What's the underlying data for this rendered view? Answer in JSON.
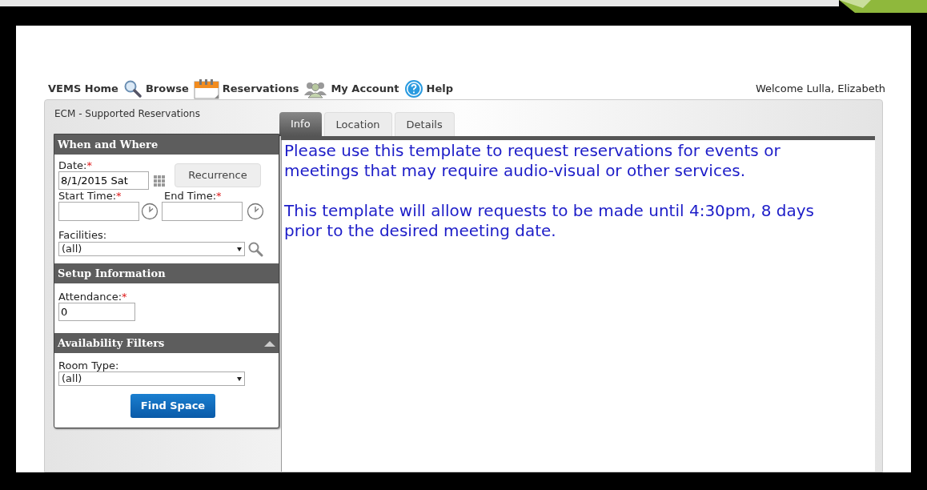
{
  "nav": {
    "items": [
      {
        "label": "VEMS Home"
      },
      {
        "label": "Browse"
      },
      {
        "label": "Reservations"
      },
      {
        "label": "My Account"
      },
      {
        "label": "Help"
      }
    ],
    "welcome": "Welcome Lulla, Elizabeth"
  },
  "panel_title": "ECM - Supported Reservations",
  "tabs": [
    {
      "label": "Info",
      "selected": true
    },
    {
      "label": "Location",
      "selected": false
    },
    {
      "label": "Details",
      "selected": false
    }
  ],
  "when_where": {
    "title": "When and Where",
    "date": {
      "label": "Date:",
      "required_mark": "*",
      "value": "8/1/2015 Sat"
    },
    "recurrence": "Recurrence",
    "start_time": {
      "label": "Start Time:",
      "required_mark": "*"
    },
    "end_time": {
      "label": "End Time:",
      "required_mark": "*"
    },
    "facilities": {
      "label": "Facilities:",
      "value": "(all)"
    }
  },
  "setup": {
    "title": "Setup Information",
    "attendance": {
      "label": "Attendance:",
      "required_mark": "*",
      "value": "0"
    }
  },
  "filters": {
    "title": "Availability Filters",
    "expanded": true,
    "room_type": {
      "label": "Room Type:",
      "value": "(all)"
    },
    "button": "Find Space"
  },
  "info": {
    "paragraphs": [
      "Please use this template to request reservations for events or meetings that may require audio-visual or other services.",
      "This template will allow requests to be made until 4:30pm, 8 days prior to the desired meeting date."
    ]
  }
}
